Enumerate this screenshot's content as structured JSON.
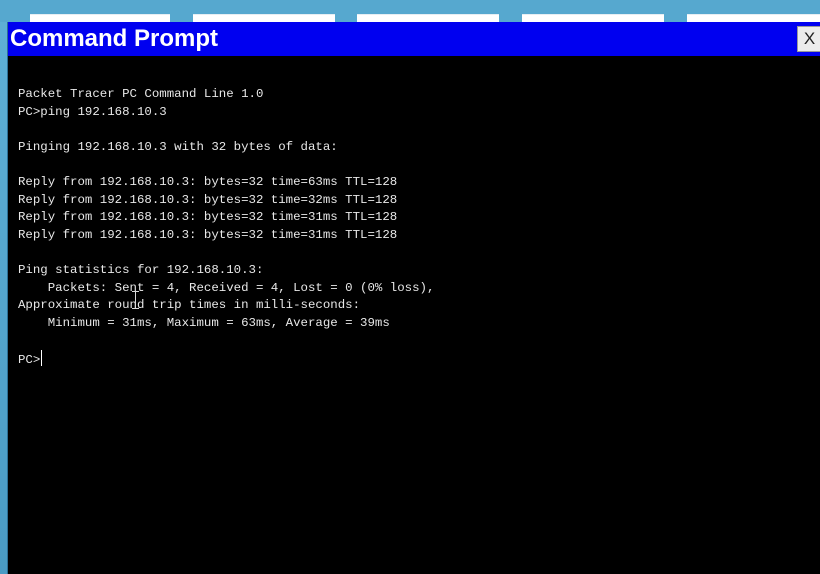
{
  "window": {
    "title": "Command Prompt",
    "close_label": "X"
  },
  "terminal": {
    "lines": [
      "Packet Tracer PC Command Line 1.0",
      "PC>ping 192.168.10.3",
      "",
      "Pinging 192.168.10.3 with 32 bytes of data:",
      "",
      "Reply from 192.168.10.3: bytes=32 time=63ms TTL=128",
      "Reply from 192.168.10.3: bytes=32 time=32ms TTL=128",
      "Reply from 192.168.10.3: bytes=32 time=31ms TTL=128",
      "Reply from 192.168.10.3: bytes=32 time=31ms TTL=128",
      "",
      "Ping statistics for 192.168.10.3:",
      "    Packets: Sent = 4, Received = 4, Lost = 0 (0% loss),",
      "Approximate round trip times in milli-seconds:",
      "    Minimum = 31ms, Maximum = 63ms, Average = 39ms",
      ""
    ],
    "prompt": "PC>"
  },
  "colors": {
    "titlebar": "#0000f0",
    "console_bg": "#000000",
    "console_text": "#e8e8e8",
    "desktop": "#4f9fc7"
  }
}
